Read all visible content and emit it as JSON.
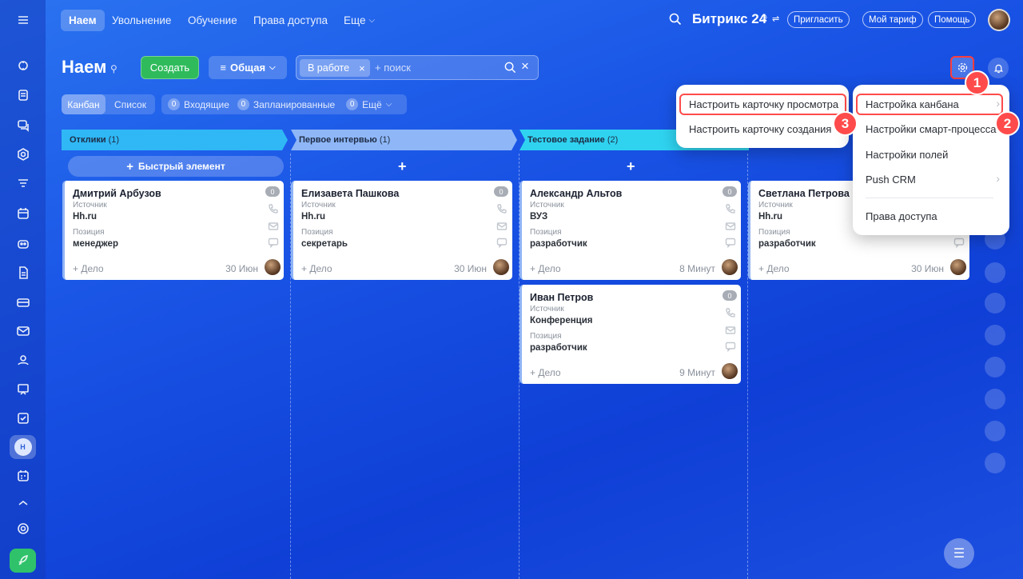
{
  "app": {
    "brand": "Битрикс 24"
  },
  "topnav": {
    "items": [
      {
        "label": "Наем"
      },
      {
        "label": "Увольнение"
      },
      {
        "label": "Обучение"
      },
      {
        "label": "Права доступа"
      },
      {
        "label": "Еще"
      }
    ],
    "invite": "Пригласить",
    "tariff": "Мой тариф",
    "help": "Помощь"
  },
  "page": {
    "title": "Наем",
    "create_label": "Создать",
    "category_label": "Общая",
    "filter_chip": "В работе",
    "search_placeholder": "+ поиск"
  },
  "view": {
    "kanban": "Канбан",
    "list": "Список",
    "counters": [
      {
        "count": "0",
        "label": "Входящие"
      },
      {
        "count": "0",
        "label": "Запланированные"
      },
      {
        "count": "0",
        "label": "Ещё"
      }
    ]
  },
  "columns": [
    {
      "title": "Отклики",
      "count": "(1)",
      "quick_add": "Быстрый элемент",
      "color": "#2fb8f5"
    },
    {
      "title": "Первое интервью",
      "count": "(1)",
      "color": "#8fb7f7"
    },
    {
      "title": "Тестовое задание",
      "count": "(2)",
      "color": "#2fd3f0"
    }
  ],
  "cards": [
    {
      "name": "Дмитрий Арбузов",
      "source_label": "Источник",
      "source": "Hh.ru",
      "position_label": "Позиция",
      "position": "менеджер",
      "badge": "0",
      "add": "+ Дело",
      "date": "30 Июн"
    },
    {
      "name": "Елизавета Пашкова",
      "source_label": "Источник",
      "source": "Hh.ru",
      "position_label": "Позиция",
      "position": "секретарь",
      "badge": "0",
      "add": "+ Дело",
      "date": "30 Июн"
    },
    {
      "name": "Александр Альтов",
      "source_label": "Источник",
      "source": "ВУЗ",
      "position_label": "Позиция",
      "position": "разработчик",
      "badge": "0",
      "add": "+ Дело",
      "date": "8 Минут"
    },
    {
      "name": "Иван Петров",
      "source_label": "Источник",
      "source": "Конференция",
      "position_label": "Позиция",
      "position": "разработчик",
      "badge": "0",
      "add": "+ Дело",
      "date": "9 Минут"
    },
    {
      "name": "Светлана Петрова",
      "source_label": "Источник",
      "source": "Hh.ru",
      "position_label": "Позиция",
      "position": "разработчик",
      "badge": "0",
      "add": "+ Дело",
      "date": "30 Июн"
    }
  ],
  "settings_menu": {
    "items": [
      {
        "label": "Настройка канбана"
      },
      {
        "label": "Настройки смарт-процесса"
      },
      {
        "label": "Настройки полей"
      },
      {
        "label": "Push CRM"
      },
      {
        "label": "Права доступа"
      }
    ]
  },
  "kanban_submenu": {
    "items": [
      {
        "label": "Настроить карточку просмотра"
      },
      {
        "label": "Настроить карточку создания"
      }
    ]
  },
  "steps": [
    "1",
    "2",
    "3"
  ]
}
